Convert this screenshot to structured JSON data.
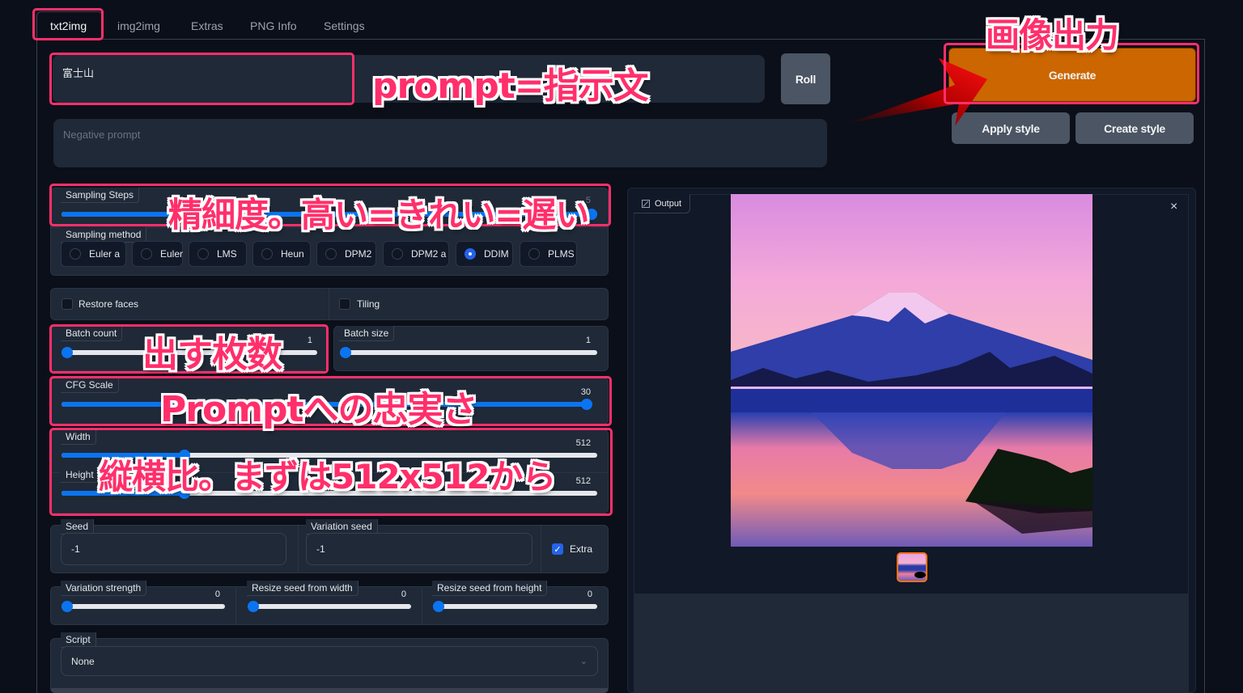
{
  "tabs": [
    {
      "label": "txt2img",
      "active": true
    },
    {
      "label": "img2img"
    },
    {
      "label": "Extras"
    },
    {
      "label": "PNG Info"
    },
    {
      "label": "Settings"
    }
  ],
  "prompt": {
    "value": "富士山"
  },
  "negative_prompt": {
    "placeholder": "Negative prompt",
    "value": ""
  },
  "buttons": {
    "roll": "Roll",
    "generate": "Generate",
    "apply_style": "Apply style",
    "create_style": "Create style"
  },
  "sampling_steps": {
    "label": "Sampling Steps",
    "value": "5",
    "fraction": 1.0
  },
  "sampling_method": {
    "label": "Sampling method",
    "options": [
      "Euler a",
      "Euler",
      "LMS",
      "Heun",
      "DPM2",
      "DPM2 a",
      "DDIM",
      "PLMS"
    ],
    "selected": "DDIM"
  },
  "restore_faces": {
    "label": "Restore faces",
    "checked": false
  },
  "tiling": {
    "label": "Tiling",
    "checked": false
  },
  "batch_count": {
    "label": "Batch count",
    "value": "1",
    "fraction": 0.0
  },
  "batch_size": {
    "label": "Batch size",
    "value": "1",
    "fraction": 0.0
  },
  "cfg_scale": {
    "label": "CFG Scale",
    "value": "30",
    "fraction": 1.0
  },
  "width": {
    "label": "Width",
    "value": "512",
    "fraction": 0.23
  },
  "height": {
    "label": "Height",
    "value": "512",
    "fraction": 0.23
  },
  "seed": {
    "label": "Seed",
    "value": "-1"
  },
  "variation_seed": {
    "label": "Variation seed",
    "value": "-1"
  },
  "extra": {
    "label": "Extra",
    "checked": true
  },
  "variation_strength": {
    "label": "Variation strength",
    "value": "0",
    "fraction": 0.0
  },
  "resize_seed_width": {
    "label": "Resize seed from width",
    "value": "0",
    "fraction": 0.0
  },
  "resize_seed_height": {
    "label": "Resize seed from height",
    "value": "0",
    "fraction": 0.0
  },
  "script": {
    "label": "Script",
    "selected": "None"
  },
  "output": {
    "label": "Output",
    "close": "×"
  },
  "annotations": {
    "generate": "画像出力",
    "prompt": "prompt=指示文",
    "steps": "精細度。高い=きれい=遅い",
    "batch": "出す枚数",
    "cfg": "Promptへの忠実さ",
    "size": "縦横比。まずは512x512から"
  },
  "colors": {
    "accent": "#0b74f0",
    "generate": "#cc6600",
    "annotation": "#ff2f6b"
  }
}
